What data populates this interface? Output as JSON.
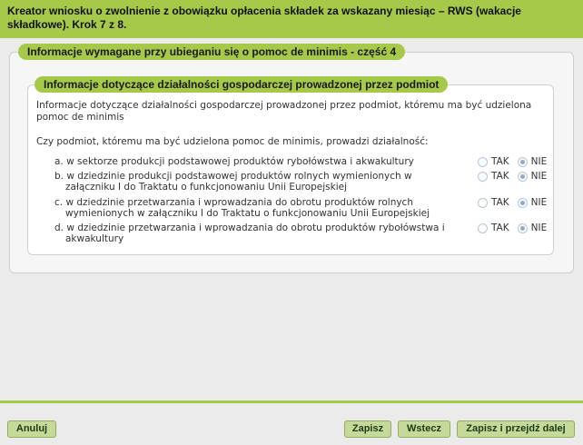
{
  "header": {
    "title": "Kreator wniosku o zwolnienie z obowiązku opłacenia składek za wskazany miesiąc – RWS (wakacje składkowe). Krok 7 z 8."
  },
  "section1": {
    "title": "Informacje wymagane przy ubieganiu się o pomoc de minimis - część 4"
  },
  "section2": {
    "title": "Informacje dotyczące działalności gospodarczej prowadzonej przez podmiot",
    "description": "Informacje dotyczące działalności gospodarczej prowadzonej przez podmiot, któremu ma być udzielona pomoc de minimis",
    "question": "Czy podmiot, któremu ma być udzielona pomoc de minimis, prowadzi działalność:",
    "items": [
      {
        "text": "a. w sektorze produkcji podstawowej produktów rybołówstwa i akwakultury",
        "yes": "TAK",
        "no": "NIE",
        "selected": "NIE"
      },
      {
        "text": "b. w dziedzinie produkcji podstawowej produktów rolnych wymienionych w załączniku I do Traktatu o funkcjonowaniu Unii Europejskiej",
        "yes": "TAK",
        "no": "NIE",
        "selected": "NIE"
      },
      {
        "text": "c. w dziedzinie przetwarzania i wprowadzania do obrotu produktów rolnych wymienionych w załączniku I do Traktatu o funkcjonowaniu Unii Europejskiej",
        "yes": "TAK",
        "no": "NIE",
        "selected": "NIE"
      },
      {
        "text": "d. w dziedzinie przetwarzania i wprowadzania do obrotu produktów rybołówstwa i akwakultury",
        "yes": "TAK",
        "no": "NIE",
        "selected": "NIE"
      }
    ]
  },
  "buttons": {
    "cancel": "Anuluj",
    "save": "Zapisz",
    "back": "Wstecz",
    "save_next": "Zapisz i przejdź dalej"
  },
  "colors": {
    "accent": "#a6c949",
    "button": "#c5d99a",
    "background": "#ebebeb"
  }
}
